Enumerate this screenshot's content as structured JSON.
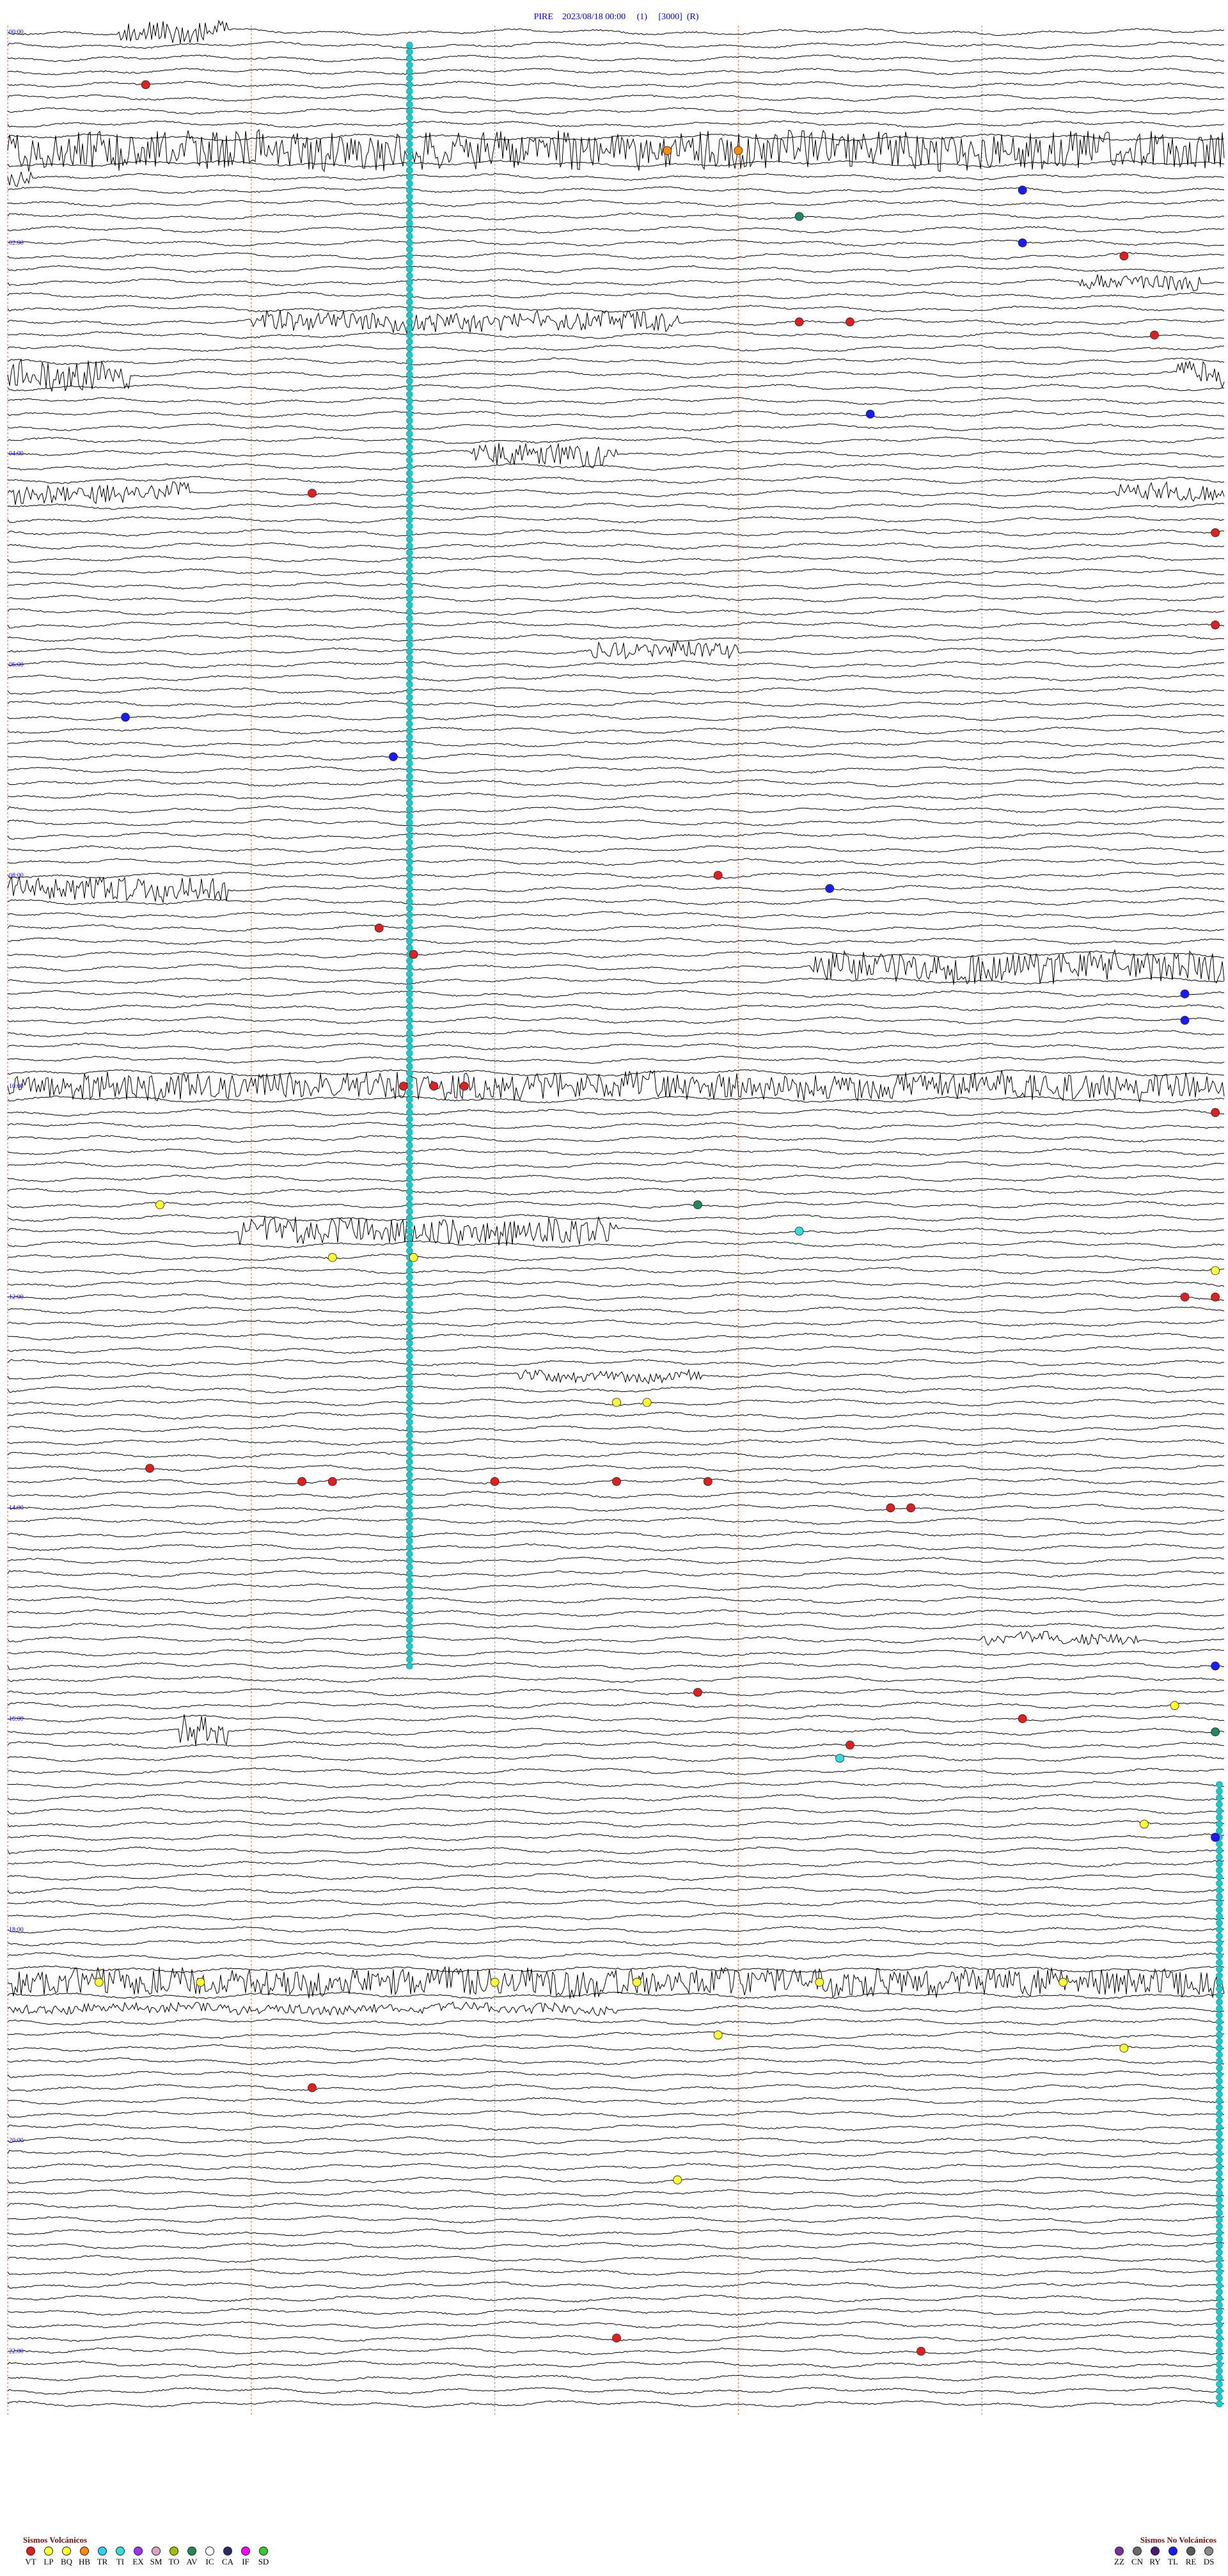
{
  "header": {
    "station": "PIRE",
    "datetime": "2023/08/18 00:00",
    "channel": "(1)",
    "scale": "[3000]",
    "flag": "(R)"
  },
  "chart_data": {
    "type": "helicorder",
    "title": "PIRE    2023/08/18 00:00     (1)     [3000]  (R)",
    "hours": 24,
    "rows_per_hour": 8,
    "x_minutes": [
      0,
      60
    ],
    "trace_color": "#000000",
    "hour_labels": [
      "00:00",
      "02:00",
      "04:00",
      "06:00",
      "08:00",
      "10:00",
      "12:00",
      "14:00",
      "16:00",
      "18:00",
      "20:00",
      "22:00",
      "00:00"
    ],
    "bursts": [
      {
        "row": 0,
        "start": 0.09,
        "end": 0.18,
        "amp": 3
      },
      {
        "row": 9,
        "start": 0.0,
        "end": 1.0,
        "amp": 5
      },
      {
        "row": 11,
        "start": 0.0,
        "end": 0.02,
        "amp": 2
      },
      {
        "row": 19,
        "start": 0.88,
        "end": 0.98,
        "amp": 2
      },
      {
        "row": 22,
        "start": 0.2,
        "end": 0.55,
        "amp": 2.5
      },
      {
        "row": 26,
        "start": 0.0,
        "end": 0.1,
        "amp": 4
      },
      {
        "row": 26,
        "start": 0.96,
        "end": 1.0,
        "amp": 3
      },
      {
        "row": 32,
        "start": 0.38,
        "end": 0.5,
        "amp": 3
      },
      {
        "row": 35,
        "start": 0.0,
        "end": 0.15,
        "amp": 2.5
      },
      {
        "row": 35,
        "start": 0.91,
        "end": 1.0,
        "amp": 2.5
      },
      {
        "row": 47,
        "start": 0.48,
        "end": 0.6,
        "amp": 2
      },
      {
        "row": 65,
        "start": 0.0,
        "end": 0.18,
        "amp": 3
      },
      {
        "row": 71,
        "start": 0.66,
        "end": 1.0,
        "amp": 4
      },
      {
        "row": 80,
        "start": 0.0,
        "end": 1.0,
        "amp": 3.5
      },
      {
        "row": 91,
        "start": 0.19,
        "end": 0.5,
        "amp": 3.5
      },
      {
        "row": 102,
        "start": 0.42,
        "end": 0.57,
        "amp": 1.5
      },
      {
        "row": 122,
        "start": 0.8,
        "end": 0.93,
        "amp": 1.5
      },
      {
        "row": 129,
        "start": 0.14,
        "end": 0.18,
        "amp": 4
      },
      {
        "row": 148,
        "start": 0.0,
        "end": 1.0,
        "amp": 3.5
      },
      {
        "row": 150,
        "start": 0.0,
        "end": 0.5,
        "amp": 1.2
      }
    ],
    "event_lines": [
      {
        "minute": 19.8,
        "rows": [
          1,
          124
        ],
        "color": "#1ec8c8"
      },
      {
        "minute": 59.7,
        "rows": [
          133,
          180
        ],
        "color": "#1ec8c8"
      }
    ],
    "events": [
      {
        "row": 4,
        "minute": 6.8,
        "type": "VT"
      },
      {
        "row": 9,
        "minute": 32.5,
        "type": "HB"
      },
      {
        "row": 9,
        "minute": 36.0,
        "type": "HB"
      },
      {
        "row": 12,
        "minute": 50.0,
        "type": "TL"
      },
      {
        "row": 14,
        "minute": 39.0,
        "type": "AV"
      },
      {
        "row": 16,
        "minute": 50.0,
        "type": "TL"
      },
      {
        "row": 17,
        "minute": 55.0,
        "type": "VT"
      },
      {
        "row": 22,
        "minute": 39.0,
        "type": "VT"
      },
      {
        "row": 22,
        "minute": 41.5,
        "type": "VT"
      },
      {
        "row": 23,
        "minute": 56.5,
        "type": "VT"
      },
      {
        "row": 29,
        "minute": 42.5,
        "type": "TL"
      },
      {
        "row": 35,
        "minute": 15.0,
        "type": "VT"
      },
      {
        "row": 38,
        "minute": 83.0,
        "type": "VT"
      },
      {
        "row": 45,
        "minute": 70.0,
        "type": "VT"
      },
      {
        "row": 52,
        "minute": 5.8,
        "type": "TL"
      },
      {
        "row": 55,
        "minute": 19.0,
        "type": "TL"
      },
      {
        "row": 64,
        "minute": 35.0,
        "type": "VT"
      },
      {
        "row": 65,
        "minute": 40.5,
        "type": "TL"
      },
      {
        "row": 68,
        "minute": 18.3,
        "type": "VT"
      },
      {
        "row": 70,
        "minute": 20.0,
        "type": "VT"
      },
      {
        "row": 73,
        "minute": 58.0,
        "type": "TL"
      },
      {
        "row": 75,
        "minute": 58.0,
        "type": "TL"
      },
      {
        "row": 80,
        "minute": 19.5,
        "type": "VT"
      },
      {
        "row": 80,
        "minute": 21.0,
        "type": "VT"
      },
      {
        "row": 80,
        "minute": 22.5,
        "type": "VT"
      },
      {
        "row": 82,
        "minute": 85.0,
        "type": "VT"
      },
      {
        "row": 89,
        "minute": 7.5,
        "type": "BQ"
      },
      {
        "row": 89,
        "minute": 34.0,
        "type": "AV"
      },
      {
        "row": 91,
        "minute": 39.0,
        "type": "TI"
      },
      {
        "row": 93,
        "minute": 16.0,
        "type": "BQ"
      },
      {
        "row": 93,
        "minute": 20.0,
        "type": "BQ"
      },
      {
        "row": 94,
        "minute": 62.0,
        "type": "BQ"
      },
      {
        "row": 96,
        "minute": 58.0,
        "type": "VT"
      },
      {
        "row": 96,
        "minute": 60.5,
        "type": "VT"
      },
      {
        "row": 104,
        "minute": 30.0,
        "type": "BQ"
      },
      {
        "row": 104,
        "minute": 31.5,
        "type": "BQ"
      },
      {
        "row": 109,
        "minute": 7.0,
        "type": "VT"
      },
      {
        "row": 110,
        "minute": 14.5,
        "type": "VT"
      },
      {
        "row": 110,
        "minute": 16.0,
        "type": "VT"
      },
      {
        "row": 110,
        "minute": 24.0,
        "type": "VT"
      },
      {
        "row": 110,
        "minute": 30.0,
        "type": "VT"
      },
      {
        "row": 110,
        "minute": 34.5,
        "type": "VT"
      },
      {
        "row": 112,
        "minute": 43.5,
        "type": "VT"
      },
      {
        "row": 112,
        "minute": 44.5,
        "type": "VT"
      },
      {
        "row": 124,
        "minute": 80.0,
        "type": "TL"
      },
      {
        "row": 126,
        "minute": 34.0,
        "type": "VT"
      },
      {
        "row": 127,
        "minute": 57.5,
        "type": "BQ"
      },
      {
        "row": 128,
        "minute": 50.0,
        "type": "VT"
      },
      {
        "row": 129,
        "minute": 65.0,
        "type": "AV"
      },
      {
        "row": 130,
        "minute": 41.5,
        "type": "VT"
      },
      {
        "row": 131,
        "minute": 41.0,
        "type": "TI"
      },
      {
        "row": 136,
        "minute": 56.0,
        "type": "BQ"
      },
      {
        "row": 137,
        "minute": 62.5,
        "type": "BQ"
      },
      {
        "row": 137,
        "minute": 86.0,
        "type": "TL"
      },
      {
        "row": 148,
        "minute": 4.5,
        "type": "BQ"
      },
      {
        "row": 148,
        "minute": 9.5,
        "type": "BQ"
      },
      {
        "row": 148,
        "minute": 24.0,
        "type": "BQ"
      },
      {
        "row": 148,
        "minute": 31.0,
        "type": "BQ"
      },
      {
        "row": 148,
        "minute": 40.0,
        "type": "BQ"
      },
      {
        "row": 148,
        "minute": 52.0,
        "type": "BQ"
      },
      {
        "row": 152,
        "minute": 35.0,
        "type": "BQ"
      },
      {
        "row": 153,
        "minute": 55.0,
        "type": "BQ"
      },
      {
        "row": 156,
        "minute": 15.0,
        "type": "VT"
      },
      {
        "row": 163,
        "minute": 33.0,
        "type": "BQ"
      },
      {
        "row": 175,
        "minute": 30.0,
        "type": "VT"
      },
      {
        "row": 176,
        "minute": 45.0,
        "type": "VT"
      }
    ]
  },
  "legend": {
    "volcanic_title": "Sismos Volcánicos",
    "volcanic": [
      {
        "code": "VT",
        "color": "#e02020"
      },
      {
        "code": "LP",
        "color": "#ffff33"
      },
      {
        "code": "BQ",
        "color": "#ffff33"
      },
      {
        "code": "HB",
        "color": "#ff8c00"
      },
      {
        "code": "TR",
        "color": "#33ccff"
      },
      {
        "code": "TI",
        "color": "#33dddd"
      },
      {
        "code": "EX",
        "color": "#9b30ff"
      },
      {
        "code": "SM",
        "color": "#e0a0c0"
      },
      {
        "code": "TO",
        "color": "#a0c000"
      },
      {
        "code": "AV",
        "color": "#1e8a5a"
      },
      {
        "code": "IC",
        "color": "#ffffff"
      },
      {
        "code": "CA",
        "color": "#2a2a6a"
      },
      {
        "code": "IF",
        "color": "#ff00ff"
      },
      {
        "code": "SD",
        "color": "#33cc33"
      }
    ],
    "nonvolcanic_title": "Sismos No Volcánicos",
    "nonvolcanic": [
      {
        "code": "ZZ",
        "color": "#7a2fa0"
      },
      {
        "code": "CN",
        "color": "#6a6a6a"
      },
      {
        "code": "RY",
        "color": "#4a1a7a"
      },
      {
        "code": "TL",
        "color": "#1a1aff"
      },
      {
        "code": "RE",
        "color": "#5a5a5a"
      },
      {
        "code": "DS",
        "color": "#8a8a8a"
      }
    ]
  }
}
